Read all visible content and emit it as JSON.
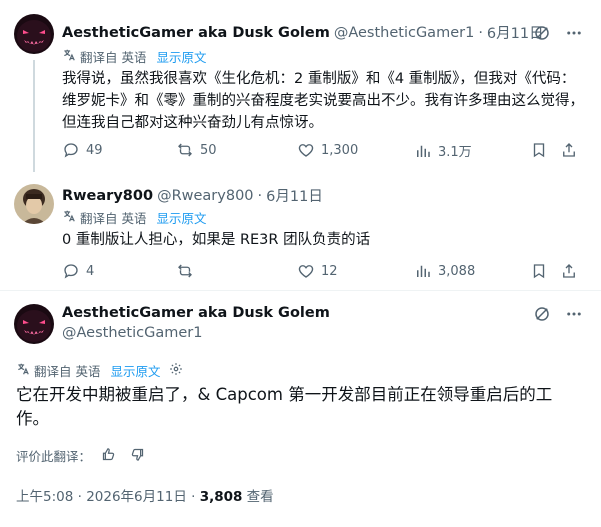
{
  "tweet1": {
    "name": "AestheticGamer aka Dusk Golem",
    "handle": "@AestheticGamer1",
    "sep": "·",
    "time": "6月11日",
    "translated_from": "翻译自 英语",
    "show_original": "显示原文",
    "text": "我得说，虽然我很喜欢《生化危机：2 重制版》和《4 重制版》，但我对《代码：维罗妮卡》和《零》重制的兴奋程度老实说要高出不少。我有许多理由这么觉得，但连我自己都对这种兴奋劲儿有点惊讶。",
    "replies": "49",
    "retweets": "50",
    "likes": "1,300",
    "views": "3.1万"
  },
  "tweet2": {
    "name": "Rweary800",
    "handle": "@Rweary800",
    "sep": "·",
    "time": "6月11日",
    "translated_from": "翻译自 英语",
    "show_original": "显示原文",
    "text": "0 重制版让人担心，如果是 RE3R 团队负责的话",
    "replies": "4",
    "retweets": "",
    "likes": "12",
    "views": "3,088"
  },
  "tweet3": {
    "name": "AestheticGamer aka Dusk Golem",
    "handle": "@AestheticGamer1",
    "translated_from": "翻译自 英语",
    "show_original": "显示原文",
    "text": "它在开发中期被重启了，& Capcom 第一开发部目前正在领导重启后的工作。",
    "rate_label": "评价此翻译：",
    "timestamp": "上午5:08 · 2026年6月11日 · ",
    "views_count": "3,808",
    "views_label": " 查看"
  },
  "colors": {
    "text": "#0f1419",
    "secondary": "#536471",
    "link": "#1d9bf0",
    "divider": "#eff3f4"
  }
}
